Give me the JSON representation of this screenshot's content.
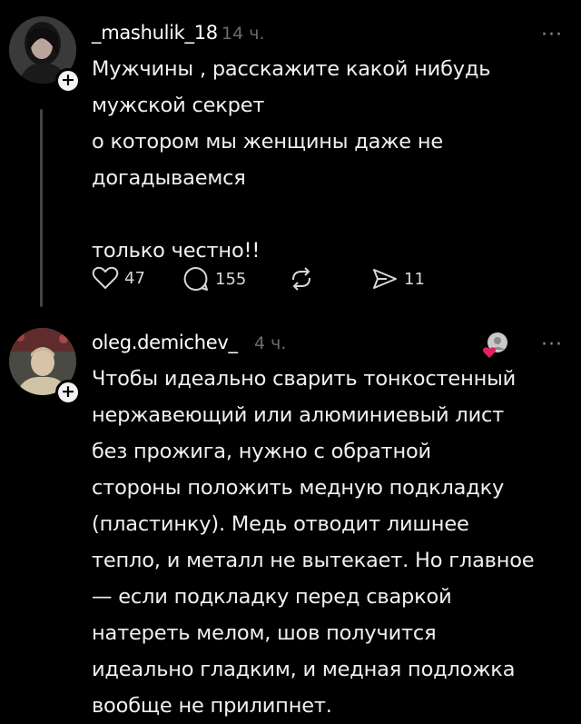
{
  "posts": [
    {
      "username": "_mashulik_18",
      "time": "14 ч.",
      "text": "Мужчины , расскажите какой нибудь\nмужской секрет\nо котором мы женщины  даже не\nдогадываемся\n\nтолько честно!!",
      "likes": "47",
      "comments": "155",
      "shares": "11"
    },
    {
      "username": "oleg.demichev_",
      "time": "4 ч.",
      "text": "Чтобы идеально сварить тонкостенный\nнержавеющий или алюминиевый лист\nбез прожига, нужно с обратной\nстороны положить медную подкладку\n(пластинку). Медь отводит лишнее\nтепло, и металл не вытекает. Но главное\n— если подкладку перед сваркой\nнатереть мелом, шов получится\nидеально гладким, и медная подложка\nвообще не прилипнет."
    }
  ],
  "more_label": "···",
  "plus_label": "+",
  "colors": {
    "background": "#000000",
    "text": "#f0f0f0",
    "muted": "#6b6b6b",
    "liked": "#e0245e"
  }
}
